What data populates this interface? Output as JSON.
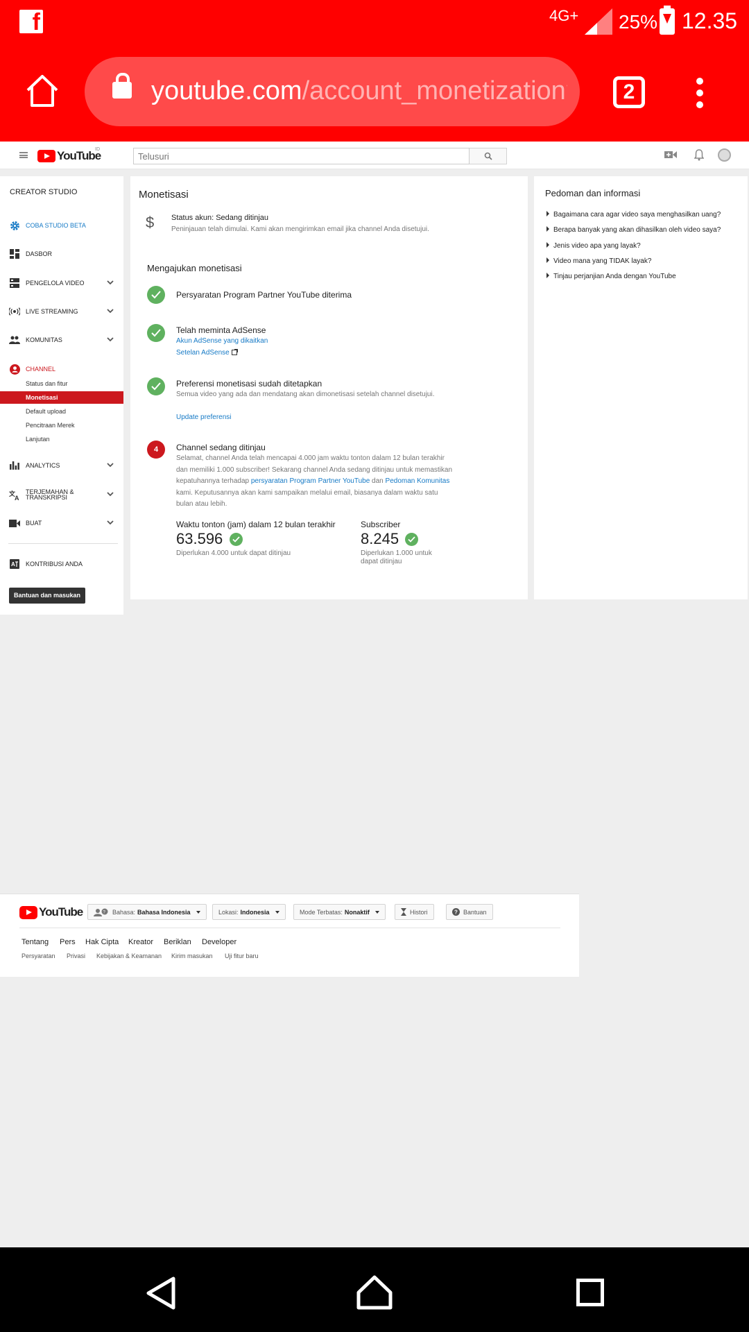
{
  "status_bar": {
    "network": "4G+",
    "battery_percent": "25%",
    "time": "12.35",
    "app_icon": "facebook-icon"
  },
  "browser": {
    "url_host": "youtube.com",
    "url_rest": "/account_monetization?c",
    "tab_count": "2"
  },
  "masthead": {
    "logo_text": "YouTube",
    "region": "ID",
    "search_placeholder": "Telusuri"
  },
  "sidebar": {
    "title": "CREATOR STUDIO",
    "items": [
      {
        "label": "COBA STUDIO BETA",
        "icon": "gear-icon"
      },
      {
        "label": "DASBOR",
        "icon": "dashboard-icon"
      },
      {
        "label": "PENGELOLA VIDEO",
        "icon": "video-manager-icon"
      },
      {
        "label": "LIVE STREAMING",
        "icon": "live-icon"
      },
      {
        "label": "KOMUNITAS",
        "icon": "community-icon"
      },
      {
        "label": "CHANNEL",
        "icon": "channel-icon"
      },
      {
        "label": "ANALYTICS",
        "icon": "analytics-icon"
      },
      {
        "label": "TERJEMAHAN & TRANSKRIPSI",
        "icon": "translate-icon"
      },
      {
        "label": "BUAT",
        "icon": "create-icon"
      },
      {
        "label": "KONTRIBUSI ANDA",
        "icon": "contribute-icon"
      }
    ],
    "channel_subitems": [
      "Status dan fitur",
      "Monetisasi",
      "Default upload",
      "Pencitraan Merek",
      "Lanjutan"
    ],
    "help_button": "Bantuan dan masukan"
  },
  "main": {
    "title": "Monetisasi",
    "status_title": "Status akun: Sedang ditinjau",
    "status_desc": "Peninjauan telah dimulai. Kami akan mengirimkan email jika channel Anda disetujui.",
    "section_title": "Mengajukan monetisasi",
    "step1_title": "Persyaratan Program Partner YouTube diterima",
    "step2_title": "Telah meminta AdSense",
    "step2_link1": "Akun AdSense yang dikaitkan",
    "step2_link2": "Setelan AdSense",
    "step3_title": "Preferensi monetisasi sudah ditetapkan",
    "step3_desc": "Semua video yang ada dan mendatang akan dimonetisasi setelah channel disetujui.",
    "step3_link": "Update preferensi",
    "step4_number": "4",
    "step4_title": "Channel sedang ditinjau",
    "step4_desc_1": "Selamat, channel Anda telah mencapai 4.000 jam waktu tonton dalam 12 bulan terakhir dan memiliki 1.000 subscriber! Sekarang channel Anda sedang ditinjau untuk memastikan kepatuhannya terhadap ",
    "step4_link1": "persyaratan Program Partner YouTube",
    "step4_desc_2": " dan ",
    "step4_link2": "Pedoman Komunitas",
    "step4_desc_3": " kami. Keputusannya akan kami sampaikan melalui email, biasanya dalam waktu satu bulan atau lebih.",
    "watch_label": "Waktu tonton (jam) dalam 12 bulan terakhir",
    "watch_value": "63.596",
    "watch_note": "Diperlukan 4.000 untuk dapat ditinjau",
    "subs_label": "Subscriber",
    "subs_value": "8.245",
    "subs_note": "Diperlukan 1.000 untuk dapat ditinjau"
  },
  "info_panel": {
    "title": "Pedoman dan informasi",
    "items": [
      "Bagaimana cara agar video saya menghasilkan uang?",
      "Berapa banyak yang akan dihasilkan oleh video saya?",
      "Jenis video apa yang layak?",
      "Video mana yang TIDAK layak?",
      "Tinjau perjanjian Anda dengan YouTube"
    ]
  },
  "footer": {
    "logo_text": "YouTube",
    "language_label": "Bahasa:",
    "language_value": "Bahasa Indonesia",
    "location_label": "Lokasi:",
    "location_value": "Indonesia",
    "restricted_label": "Mode Terbatas:",
    "restricted_value": "Nonaktif",
    "history": "Histori",
    "help": "Bantuan",
    "links": [
      "Tentang",
      "Pers",
      "Hak Cipta",
      "Kreator",
      "Beriklan",
      "Developer"
    ],
    "small_links": [
      "Persyaratan",
      "Privasi",
      "Kebijakan & Keamanan",
      "Kirim masukan",
      "Uji fitur baru"
    ]
  },
  "colors": {
    "browser_red": "#ff0000",
    "yt_red": "#cc181e",
    "link_blue": "#167ac6",
    "success_green": "#5fb15f"
  }
}
